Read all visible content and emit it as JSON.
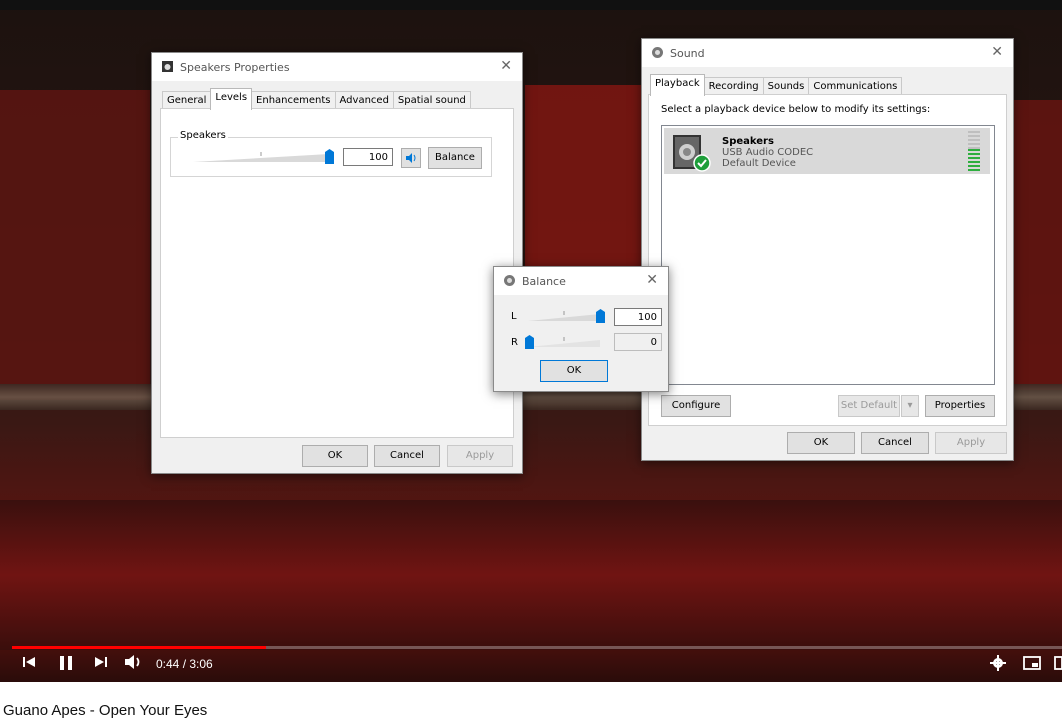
{
  "video": {
    "title": "Guano Apes - Open Your Eyes",
    "time": "0:44 / 3:06",
    "progress_fraction": 0.242
  },
  "speakers_props": {
    "title": "Speakers Properties",
    "tabs": [
      "General",
      "Levels",
      "Enhancements",
      "Advanced",
      "Spatial sound"
    ],
    "active_tab": "Levels",
    "group_label": "Speakers",
    "level_value": "100",
    "balance_label": "Balance",
    "ok_label": "OK",
    "cancel_label": "Cancel",
    "apply_label": "Apply"
  },
  "balance": {
    "title": "Balance",
    "l_label": "L",
    "r_label": "R",
    "l_value": "100",
    "r_value": "0",
    "ok_label": "OK"
  },
  "sound": {
    "title": "Sound",
    "tabs": [
      "Playback",
      "Recording",
      "Sounds",
      "Communications"
    ],
    "active_tab": "Playback",
    "instruction": "Select a playback device below to modify its settings:",
    "device": {
      "name": "Speakers",
      "driver": "USB Audio CODEC",
      "status": "Default Device"
    },
    "configure_label": "Configure",
    "set_default_label": "Set Default",
    "properties_label": "Properties",
    "ok_label": "OK",
    "cancel_label": "Cancel",
    "apply_label": "Apply"
  },
  "colors": {
    "accent": "#0078d7",
    "progress": "#ff0000",
    "check_green": "#1e9e3a"
  },
  "icons": [
    "speaker-icon",
    "close-icon",
    "volume-icon",
    "prev-icon",
    "pause-icon",
    "next-icon",
    "settings-icon",
    "miniplayer-icon"
  ]
}
